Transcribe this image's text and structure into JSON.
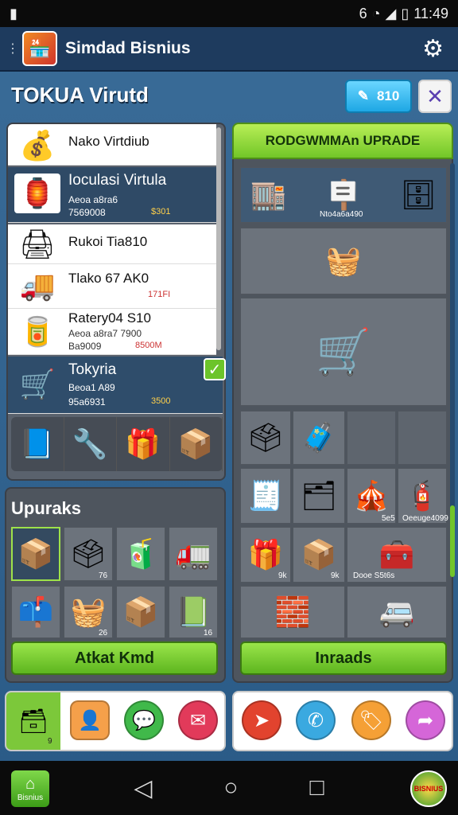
{
  "status": {
    "left_icon": "notification-icon",
    "right_text": "6",
    "time": "11:49"
  },
  "app": {
    "title": "Simdad Bisnius"
  },
  "screen": {
    "heading": "TOKUA Virutd",
    "coin_value": "810"
  },
  "shop_list": [
    {
      "name": "Nako Virtdiub",
      "sub1": "",
      "sub2": "",
      "price": ""
    },
    {
      "name": "Ioculasi Virtula",
      "sub1": "Aeoa a8ra6",
      "sub2": "7569008",
      "price": "$301"
    },
    {
      "name": "Rukoi Tia810",
      "sub1": "",
      "sub2": "",
      "price": ""
    },
    {
      "name": "Tlako 67 AK0",
      "sub1": "",
      "sub2": "",
      "price": "171FI"
    },
    {
      "name": "Ratery04 S10",
      "sub1": "Aeoa a8ra7 7900",
      "sub2": "Ba9009",
      "price": "8500M"
    },
    {
      "name": "Tokyria",
      "sub1": "Beoa1 A89",
      "sub2": "95a6931",
      "price": "3500"
    }
  ],
  "upgrade": {
    "title": "RODGWMMAn UPRADE",
    "labels": [
      "Nto4a6a490",
      "5e5",
      "Oeeuge4099",
      "9k",
      "9k",
      "Dooe S5t6s"
    ]
  },
  "lower": {
    "title": "Upuraks",
    "labels": [
      "76",
      "26",
      "16"
    ],
    "button": "Atkat Kmd"
  },
  "right_button": "Inraads",
  "bottom_badge": "9",
  "nav": {
    "home_label": "Bisnius",
    "logo_label": "BISNIUS"
  }
}
